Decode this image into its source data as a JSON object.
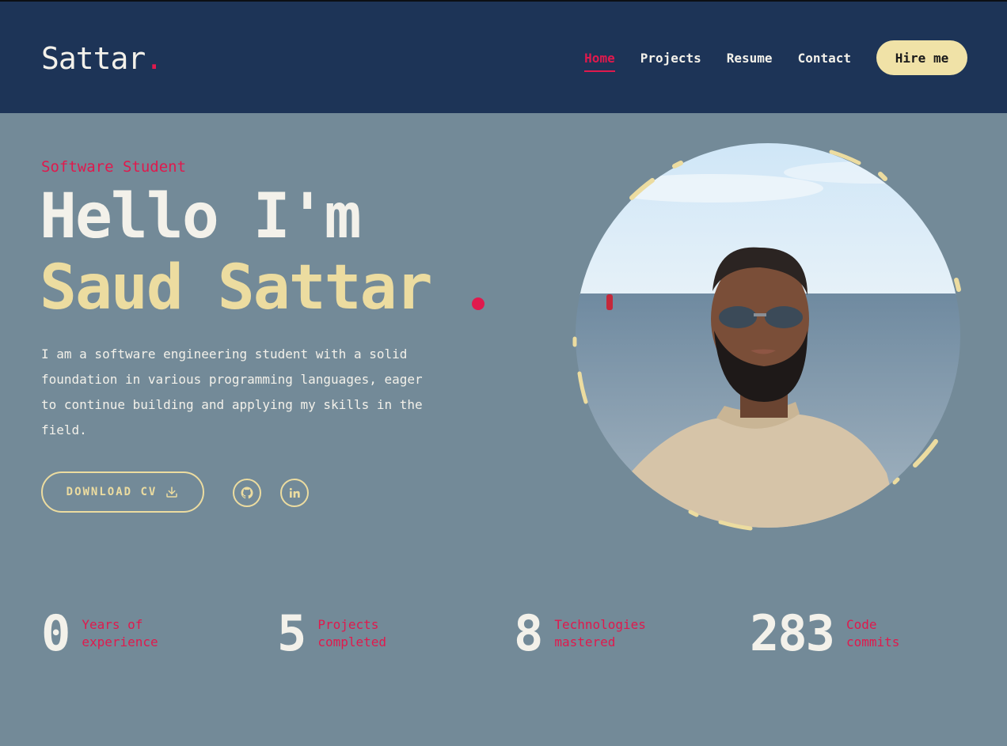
{
  "header": {
    "logo_text": "Sattar",
    "logo_dot": ".",
    "nav": [
      {
        "label": "Home",
        "active": true
      },
      {
        "label": "Projects",
        "active": false
      },
      {
        "label": "Resume",
        "active": false
      },
      {
        "label": "Contact",
        "active": false
      }
    ],
    "hire_label": "Hire me"
  },
  "hero": {
    "role": "Software Student",
    "greeting": "Hello I'm",
    "name": "Saud Sattar",
    "bio": "I am a software engineering student with a solid foundation in various programming languages, eager to continue building and applying my skills in the field.",
    "cv_label": "DOWNLOAD CV",
    "socials": [
      {
        "icon": "github-icon"
      },
      {
        "icon": "linkedin-icon"
      }
    ]
  },
  "stats": [
    {
      "value": "0",
      "label": "Years of experience"
    },
    {
      "value": "5",
      "label": "Projects completed"
    },
    {
      "value": "8",
      "label": "Technologies mastered"
    },
    {
      "value": "283",
      "label": "Code commits"
    }
  ],
  "colors": {
    "header_bg": "#1d3457",
    "page_bg": "#738a98",
    "accent": "#e0194d",
    "gold": "#ecdca0",
    "text": "#f3f1ea"
  }
}
